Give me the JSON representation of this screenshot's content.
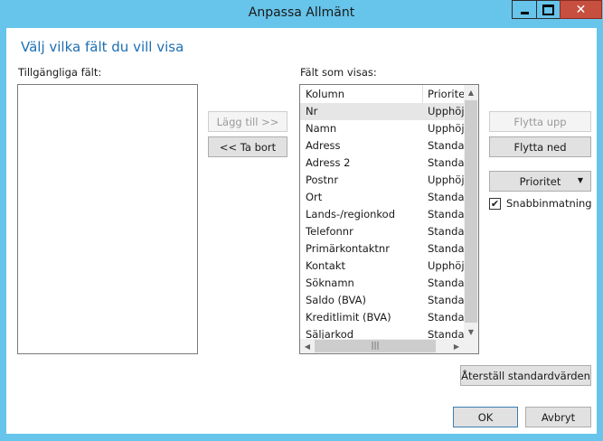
{
  "window": {
    "title": "Anpassa Allmänt"
  },
  "heading": "Välj vilka fält du vill visa",
  "available_label": "Tillgängliga fält:",
  "shown_label": "Fält som visas:",
  "buttons": {
    "add": "Lägg till >>",
    "remove": "<< Ta bort",
    "move_up": "Flytta upp",
    "move_down": "Flytta ned",
    "priority": "Prioritet",
    "reset": "Återställ standardvärden",
    "ok": "OK",
    "cancel": "Avbryt"
  },
  "quick_entry": {
    "label": "Snabbinmatning",
    "checked": true
  },
  "grid": {
    "headers": [
      "Kolumn",
      "Prioritet"
    ],
    "rows": [
      [
        "Nr",
        "Upphöjd"
      ],
      [
        "Namn",
        "Upphöjd"
      ],
      [
        "Adress",
        "Standard"
      ],
      [
        "Adress 2",
        "Standard"
      ],
      [
        "Postnr",
        "Upphöjd"
      ],
      [
        "Ort",
        "Standard"
      ],
      [
        "Lands-/regionkod",
        "Standard"
      ],
      [
        "Telefonnr",
        "Standard"
      ],
      [
        "Primärkontaktnr",
        "Standard"
      ],
      [
        "Kontakt",
        "Upphöjd"
      ],
      [
        "Söknamn",
        "Standard"
      ],
      [
        "Saldo (BVA)",
        "Standard"
      ],
      [
        "Kreditlimit (BVA)",
        "Standard"
      ],
      [
        "Säljarkod",
        "Standard"
      ]
    ]
  }
}
